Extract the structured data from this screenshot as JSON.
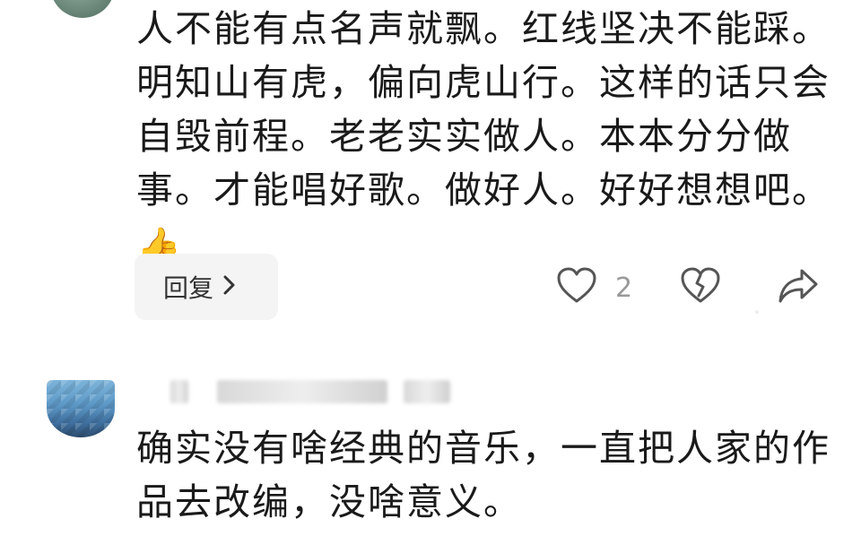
{
  "comments": [
    {
      "text": "人不能有点名声就飘。红线坚决不能踩。明知山有虎，偏向虎山行。这样的话只会自毁前程。老老实实做人。本本分分做事。才能唱好歌。做好人。好好想想吧。",
      "emoji": "👍",
      "reply_label": "回复",
      "reply_chevron": "›",
      "like_count": "2",
      "icons": {
        "like": "heart-outline-icon",
        "dislike": "broken-heart-icon",
        "share": "share-arrow-icon"
      }
    },
    {
      "text": "确实没有啥经典的音乐，一直把人家的作品去改编，没啥意义。"
    }
  ],
  "colors": {
    "text": "#1a1a1a",
    "muted": "#999999",
    "button_bg": "#f4f4f4"
  }
}
